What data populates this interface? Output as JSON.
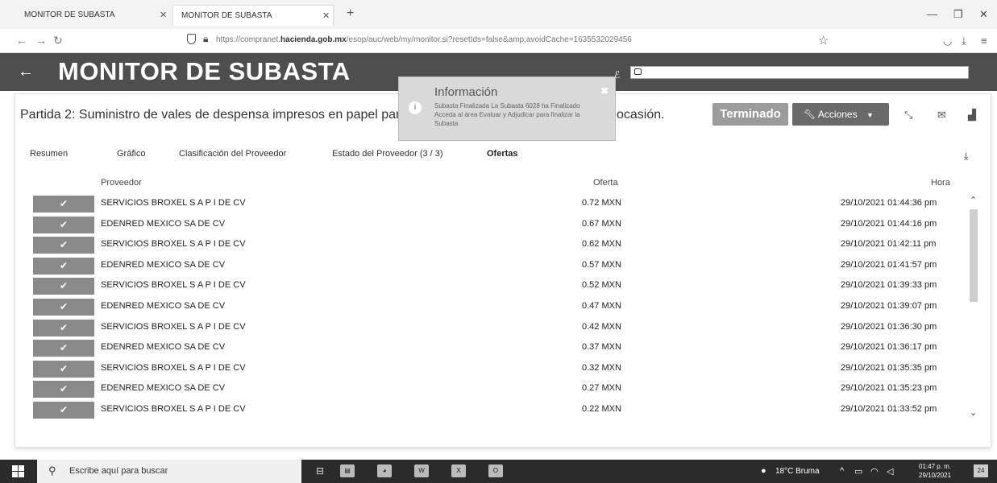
{
  "browser": {
    "tabs": [
      {
        "label": "MONITOR DE SUBASTA"
      },
      {
        "label": "MONITOR DE SUBASTA"
      }
    ],
    "url_prefix": "https://compranet.",
    "url_domain": "hacienda.gob.mx",
    "url_suffix": "/esop/auc/web/my/monitor.si?resetIds=false&amp;avoidCache=1635532029456"
  },
  "header": {
    "title": "MONITOR DE SUBASTA"
  },
  "panel": {
    "title": "Partida 2: Suministro de vales de despensa impresos en papel par",
    "title_end": "ocasión.",
    "status_label": "Terminado",
    "actions_label": "Acciones"
  },
  "subtabs": [
    {
      "label": "Resumen"
    },
    {
      "label": "Gráfico"
    },
    {
      "label": "Clasificación del Proveedor"
    },
    {
      "label": "Estado del Proveedor (3 / 3)"
    },
    {
      "label": "Ofertas"
    }
  ],
  "table": {
    "headers": {
      "proveedor": "Proveedor",
      "oferta": "Oferta",
      "hora": "Hora"
    },
    "rows": [
      {
        "proveedor": "SERVICIOS BROXEL S A P I DE CV",
        "oferta": "0.72 MXN",
        "hora": "29/10/2021 01:44:36 pm"
      },
      {
        "proveedor": "EDENRED MEXICO SA DE CV",
        "oferta": "0.67 MXN",
        "hora": "29/10/2021 01:44:16 pm"
      },
      {
        "proveedor": "SERVICIOS BROXEL S A P I DE CV",
        "oferta": "0.62 MXN",
        "hora": "29/10/2021 01:42:11 pm"
      },
      {
        "proveedor": "EDENRED MEXICO SA DE CV",
        "oferta": "0.57 MXN",
        "hora": "29/10/2021 01:41:57 pm"
      },
      {
        "proveedor": "SERVICIOS BROXEL S A P I DE CV",
        "oferta": "0.52 MXN",
        "hora": "29/10/2021 01:39:33 pm"
      },
      {
        "proveedor": "EDENRED MEXICO SA DE CV",
        "oferta": "0.47 MXN",
        "hora": "29/10/2021 01:39:07 pm"
      },
      {
        "proveedor": "SERVICIOS BROXEL S A P I DE CV",
        "oferta": "0.42 MXN",
        "hora": "29/10/2021 01:36:30 pm"
      },
      {
        "proveedor": "EDENRED MEXICO SA DE CV",
        "oferta": "0.37 MXN",
        "hora": "29/10/2021 01:36:17 pm"
      },
      {
        "proveedor": "SERVICIOS BROXEL S A P I DE CV",
        "oferta": "0.32 MXN",
        "hora": "29/10/2021 01:35:35 pm"
      },
      {
        "proveedor": "EDENRED MEXICO SA DE CV",
        "oferta": "0.27 MXN",
        "hora": "29/10/2021 01:35:23 pm"
      },
      {
        "proveedor": "SERVICIOS BROXEL S A P I DE CV",
        "oferta": "0.22 MXN",
        "hora": "29/10/2021 01:33:52 pm"
      }
    ]
  },
  "notification": {
    "title": "Información",
    "body": "Subasta Finalizada La Subasta 6028 ha Finalizado Acceda al área Evaluar y Adjudicar para finalizar la Subasta"
  },
  "taskbar": {
    "search_placeholder": "Escribe aquí para buscar",
    "weather": "18°C Bruma",
    "time": "01:47 p. m.",
    "date": "29/10/2021",
    "notification_count": "24"
  },
  "colors": {
    "header_bg": "#4e4e4e",
    "status_button": "#9b9b9b",
    "actions_button": "#6a6a6a",
    "row_check": "#8a8a8a",
    "taskbar": "#2b2b2b"
  }
}
